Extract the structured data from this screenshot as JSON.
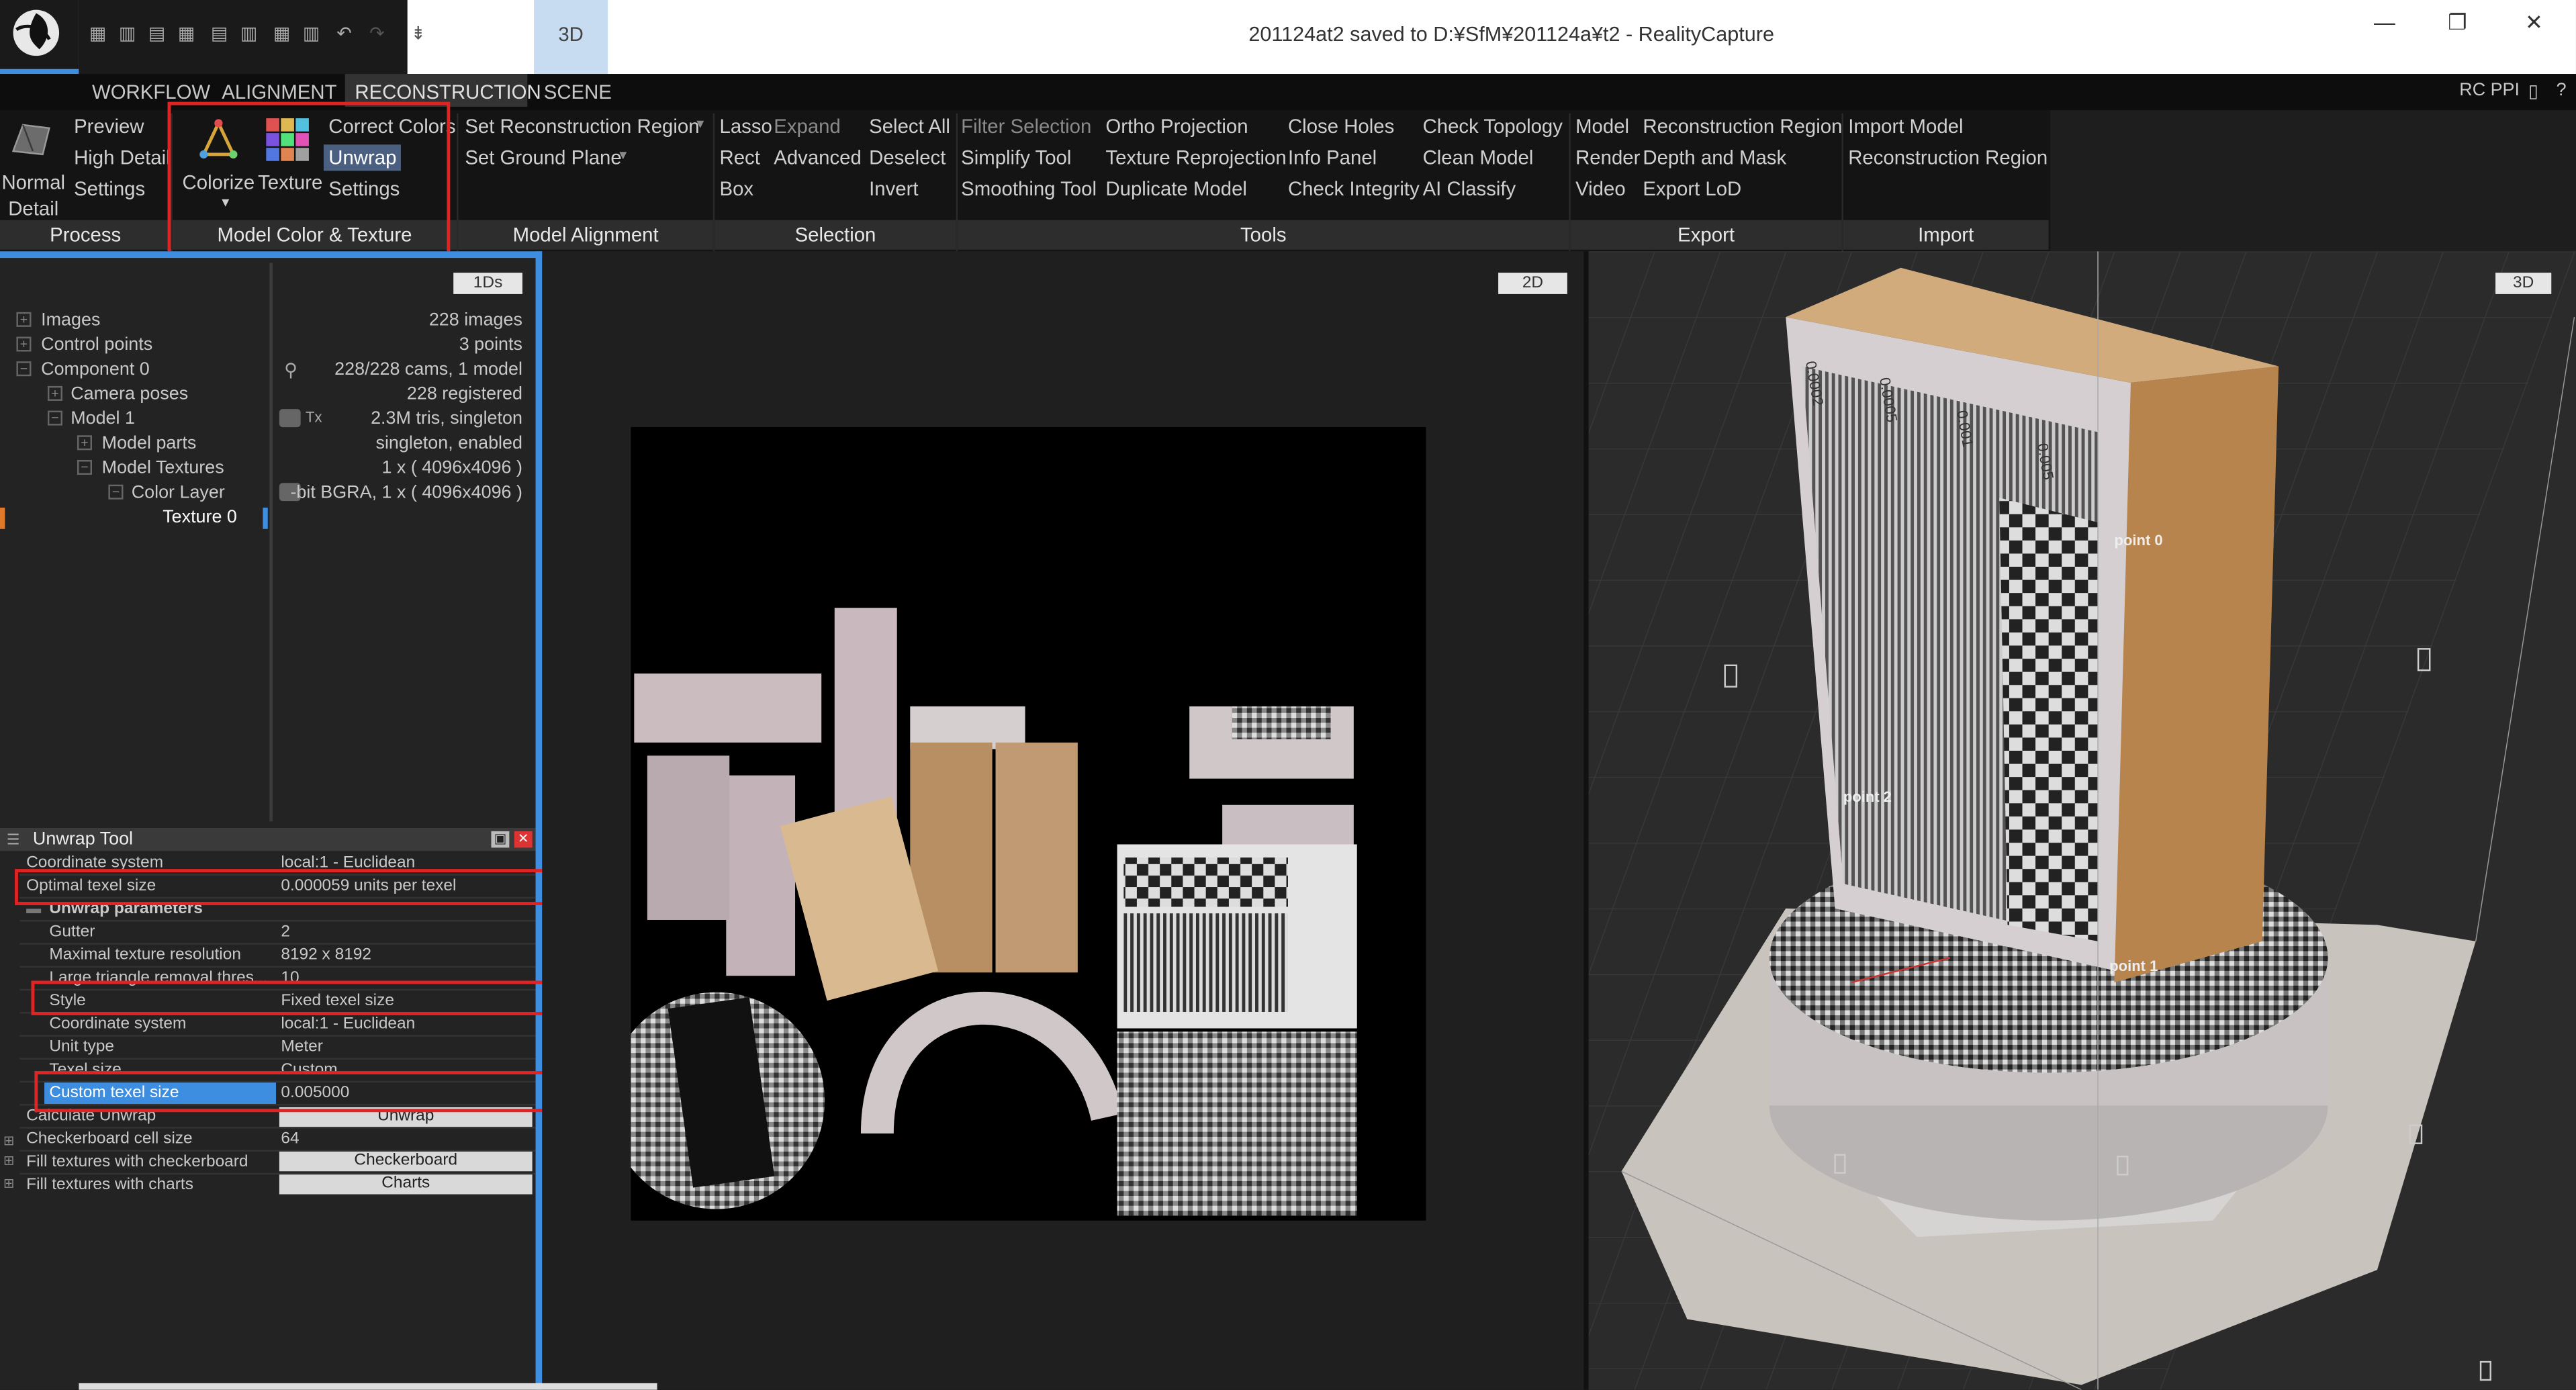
{
  "window": {
    "title": "201124at2 saved to D:¥SfM¥201124a¥t2 - RealityCapture",
    "view_tab": "3D",
    "controls": {
      "minimize": "—",
      "restore": "❐",
      "close": "✕"
    }
  },
  "menu_tabs": [
    "WORKFLOW",
    "ALIGNMENT",
    "RECONSTRUCTION",
    "SCENE"
  ],
  "menu_right": "RC PPI",
  "ribbon": {
    "process": {
      "normal_detail_1": "Normal",
      "normal_detail_2": "Detail",
      "preview": "Preview",
      "high_detail": "High Detail",
      "settings": "Settings",
      "group": "Process"
    },
    "color_texture": {
      "colorize": "Colorize",
      "texture": "Texture",
      "correct_colors": "Correct Colors",
      "unwrap": "Unwrap",
      "settings": "Settings",
      "group": "Model Color & Texture"
    },
    "alignment": {
      "set_recon_region": "Set Reconstruction Region",
      "set_ground_plane": "Set Ground Plane",
      "group": "Model Alignment"
    },
    "selection": {
      "lasso": "Lasso",
      "expand": "Expand",
      "rect": "Rect",
      "advanced": "Advanced",
      "box": "Box",
      "select_all": "Select All",
      "deselect": "Deselect",
      "invert": "Invert",
      "group": "Selection"
    },
    "tools": {
      "filter_selection": "Filter Selection",
      "simplify": "Simplify Tool",
      "smoothing": "Smoothing Tool",
      "ortho": "Ortho Projection",
      "texture_reproj": "Texture Reprojection",
      "duplicate": "Duplicate Model",
      "close_holes": "Close Holes",
      "info_panel": "Info Panel",
      "check_integrity": "Check Integrity",
      "check_topology": "Check Topology",
      "clean_model": "Clean Model",
      "ai_classify": "AI Classify",
      "group": "Tools"
    },
    "export": {
      "model": "Model",
      "render": "Render",
      "video": "Video",
      "recon_region": "Reconstruction Region",
      "depth_mask": "Depth and Mask",
      "export_lod": "Export LoD",
      "group": "Export"
    },
    "import": {
      "import_model": "Import Model",
      "recon_region": "Reconstruction Region",
      "group": "Import"
    }
  },
  "tree": {
    "panel_badge": "1Ds",
    "items": [
      {
        "label": "Images",
        "value": "228 images"
      },
      {
        "label": "Control points",
        "value": "3 points"
      },
      {
        "label": "Component 0",
        "value": "228/228 cams, 1 model"
      },
      {
        "label": "Camera poses",
        "value": "228 registered"
      },
      {
        "label": "Model 1",
        "value": "2.3M tris, singleton"
      },
      {
        "label": "Model parts",
        "value": "singleton, enabled"
      },
      {
        "label": "Model Textures",
        "value": "1 x ( 4096x4096 )"
      },
      {
        "label": "Color Layer",
        "value": "-bit BGRA, 1 x ( 4096x4096 )"
      },
      {
        "label": "Texture 0",
        "value": ""
      }
    ],
    "tx_mark": "Tx"
  },
  "unwrap_tool": {
    "title": "Unwrap Tool",
    "rows": [
      {
        "key": "Coordinate system",
        "value": "local:1 - Euclidean"
      },
      {
        "key": "Optimal texel size",
        "value": "0.000059 units per texel"
      },
      {
        "key": "Unwrap parameters",
        "value": ""
      },
      {
        "key": "Gutter",
        "value": "2"
      },
      {
        "key": "Maximal texture resolution",
        "value": "8192 x 8192"
      },
      {
        "key": "Large triangle removal thres...",
        "value": "10"
      },
      {
        "key": "Style",
        "value": "Fixed texel size"
      },
      {
        "key": "Coordinate system",
        "value": "local:1 - Euclidean"
      },
      {
        "key": "Unit type",
        "value": "Meter"
      },
      {
        "key": "Texel size",
        "value": "Custom"
      },
      {
        "key": "Custom texel size",
        "value": "0.005000"
      },
      {
        "key": "Calculate Unwrap",
        "value": "Unwrap"
      },
      {
        "key": "Checkerboard cell size",
        "value": "64"
      },
      {
        "key": "Fill textures with checkerboard",
        "value": "Checkerboard"
      },
      {
        "key": "Fill textures with charts",
        "value": "Charts"
      }
    ]
  },
  "view2d": {
    "badge": "2D"
  },
  "view3d": {
    "badge": "3D",
    "points": [
      "point 0",
      "point 1",
      "point 2"
    ],
    "scale_labels": [
      "0.0002",
      "0.0005",
      "0.001",
      "0.005"
    ]
  },
  "colors": {
    "accent": "#3d8ee0",
    "highlight_box": "#e02424",
    "selected_row": "#3d8ee0"
  }
}
